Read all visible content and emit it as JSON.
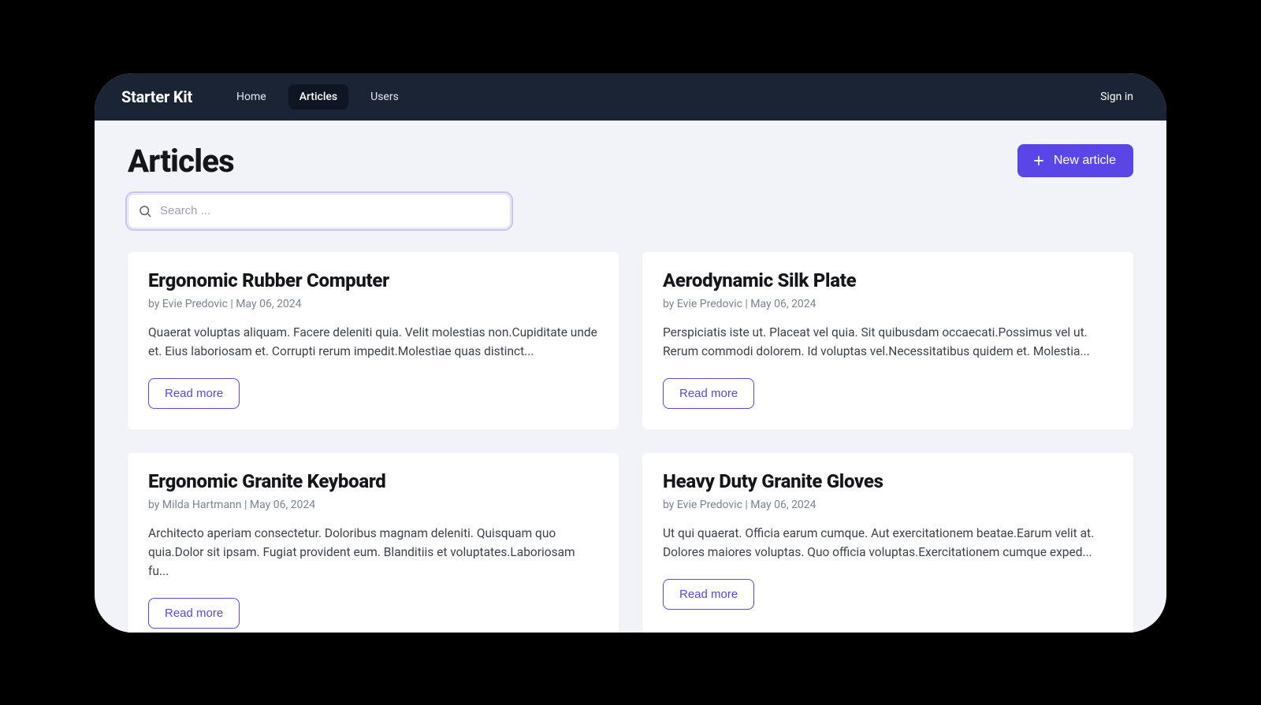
{
  "brand": "Starter Kit",
  "nav": {
    "home": "Home",
    "articles": "Articles",
    "users": "Users"
  },
  "signin": "Sign in",
  "page_title": "Articles",
  "new_button": "New article",
  "search": {
    "placeholder": "Search ..."
  },
  "byline_prefix": "by ",
  "byline_sep": " | ",
  "read_more": "Read more",
  "articles": [
    {
      "title": "Ergonomic Rubber Computer",
      "author": "Evie Predovic",
      "date": "May 06, 2024",
      "excerpt": "Quaerat voluptas aliquam. Facere deleniti quia. Velit molestias non.Cupiditate unde et. Eius laboriosam et. Corrupti rerum impedit.Molestiae quas distinct..."
    },
    {
      "title": "Aerodynamic Silk Plate",
      "author": "Evie Predovic",
      "date": "May 06, 2024",
      "excerpt": "Perspiciatis iste ut. Placeat vel quia. Sit quibusdam occaecati.Possimus vel ut. Rerum commodi dolorem. Id voluptas vel.Necessitatibus quidem et. Molestia..."
    },
    {
      "title": "Ergonomic Granite Keyboard",
      "author": "Milda Hartmann",
      "date": "May 06, 2024",
      "excerpt": "Architecto aperiam consectetur. Doloribus magnam deleniti. Quisquam quo quia.Dolor sit ipsam. Fugiat provident eum. Blanditiis et voluptates.Laboriosam fu..."
    },
    {
      "title": "Heavy Duty Granite Gloves",
      "author": "Evie Predovic",
      "date": "May 06, 2024",
      "excerpt": "Ut qui quaerat. Officia earum cumque. Aut exercitationem beatae.Earum velit at. Dolores maiores voluptas. Quo officia voluptas.Exercitationem cumque exped..."
    }
  ]
}
